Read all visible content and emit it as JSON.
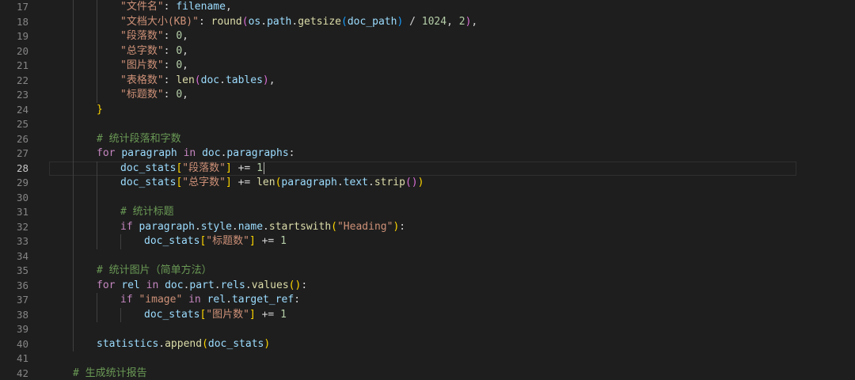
{
  "editor": {
    "current_line": 28,
    "lines": [
      {
        "no": "17",
        "tokens": [
          {
            "t": "\"文件名\"",
            "c": "str"
          },
          {
            "t": ": ",
            "c": "punc"
          },
          {
            "t": "filename",
            "c": "var"
          },
          {
            "t": ",",
            "c": "punc"
          }
        ]
      },
      {
        "no": "18",
        "tokens": [
          {
            "t": "\"文档大小(KB)\"",
            "c": "str"
          },
          {
            "t": ": ",
            "c": "punc"
          },
          {
            "t": "round",
            "c": "fn"
          },
          {
            "t": "(",
            "c": "br2"
          },
          {
            "t": "os",
            "c": "var"
          },
          {
            "t": ".",
            "c": "punc"
          },
          {
            "t": "path",
            "c": "var"
          },
          {
            "t": ".",
            "c": "punc"
          },
          {
            "t": "getsize",
            "c": "fn"
          },
          {
            "t": "(",
            "c": "br3"
          },
          {
            "t": "doc_path",
            "c": "var"
          },
          {
            "t": ")",
            "c": "br3"
          },
          {
            "t": " / ",
            "c": "punc"
          },
          {
            "t": "1024",
            "c": "num"
          },
          {
            "t": ", ",
            "c": "punc"
          },
          {
            "t": "2",
            "c": "num"
          },
          {
            "t": ")",
            "c": "br2"
          },
          {
            "t": ",",
            "c": "punc"
          }
        ]
      },
      {
        "no": "19",
        "tokens": [
          {
            "t": "\"段落数\"",
            "c": "str"
          },
          {
            "t": ": ",
            "c": "punc"
          },
          {
            "t": "0",
            "c": "num"
          },
          {
            "t": ",",
            "c": "punc"
          }
        ]
      },
      {
        "no": "20",
        "tokens": [
          {
            "t": "\"总字数\"",
            "c": "str"
          },
          {
            "t": ": ",
            "c": "punc"
          },
          {
            "t": "0",
            "c": "num"
          },
          {
            "t": ",",
            "c": "punc"
          }
        ]
      },
      {
        "no": "21",
        "tokens": [
          {
            "t": "\"图片数\"",
            "c": "str"
          },
          {
            "t": ": ",
            "c": "punc"
          },
          {
            "t": "0",
            "c": "num"
          },
          {
            "t": ",",
            "c": "punc"
          }
        ]
      },
      {
        "no": "22",
        "tokens": [
          {
            "t": "\"表格数\"",
            "c": "str"
          },
          {
            "t": ": ",
            "c": "punc"
          },
          {
            "t": "len",
            "c": "fn"
          },
          {
            "t": "(",
            "c": "br2"
          },
          {
            "t": "doc",
            "c": "var"
          },
          {
            "t": ".",
            "c": "punc"
          },
          {
            "t": "tables",
            "c": "var"
          },
          {
            "t": ")",
            "c": "br2"
          },
          {
            "t": ",",
            "c": "punc"
          }
        ]
      },
      {
        "no": "23",
        "tokens": [
          {
            "t": "\"标题数\"",
            "c": "str"
          },
          {
            "t": ": ",
            "c": "punc"
          },
          {
            "t": "0",
            "c": "num"
          },
          {
            "t": ",",
            "c": "punc"
          }
        ]
      },
      {
        "no": "24",
        "tokens": [
          {
            "t": "}",
            "c": "br1"
          }
        ]
      },
      {
        "no": "25",
        "tokens": []
      },
      {
        "no": "26",
        "tokens": [
          {
            "t": "# 统计段落和字数",
            "c": "cm"
          }
        ]
      },
      {
        "no": "27",
        "tokens": [
          {
            "t": "for",
            "c": "kw"
          },
          {
            "t": " ",
            "c": "punc"
          },
          {
            "t": "paragraph",
            "c": "var"
          },
          {
            "t": " ",
            "c": "punc"
          },
          {
            "t": "in",
            "c": "kw"
          },
          {
            "t": " ",
            "c": "punc"
          },
          {
            "t": "doc",
            "c": "var"
          },
          {
            "t": ".",
            "c": "punc"
          },
          {
            "t": "paragraphs",
            "c": "var"
          },
          {
            "t": ":",
            "c": "punc"
          }
        ]
      },
      {
        "no": "28",
        "tokens": [
          {
            "t": "doc_stats",
            "c": "var"
          },
          {
            "t": "[",
            "c": "br1"
          },
          {
            "t": "\"段落数\"",
            "c": "str"
          },
          {
            "t": "]",
            "c": "br1"
          },
          {
            "t": " += ",
            "c": "punc"
          },
          {
            "t": "1",
            "c": "num"
          }
        ]
      },
      {
        "no": "29",
        "tokens": [
          {
            "t": "doc_stats",
            "c": "var"
          },
          {
            "t": "[",
            "c": "br1"
          },
          {
            "t": "\"总字数\"",
            "c": "str"
          },
          {
            "t": "]",
            "c": "br1"
          },
          {
            "t": " += ",
            "c": "punc"
          },
          {
            "t": "len",
            "c": "fn"
          },
          {
            "t": "(",
            "c": "br1"
          },
          {
            "t": "paragraph",
            "c": "var"
          },
          {
            "t": ".",
            "c": "punc"
          },
          {
            "t": "text",
            "c": "var"
          },
          {
            "t": ".",
            "c": "punc"
          },
          {
            "t": "strip",
            "c": "fn"
          },
          {
            "t": "(",
            "c": "br2"
          },
          {
            "t": ")",
            "c": "br2"
          },
          {
            "t": ")",
            "c": "br1"
          }
        ]
      },
      {
        "no": "30",
        "tokens": []
      },
      {
        "no": "31",
        "tokens": [
          {
            "t": "# 统计标题",
            "c": "cm"
          }
        ]
      },
      {
        "no": "32",
        "tokens": [
          {
            "t": "if",
            "c": "kw"
          },
          {
            "t": " ",
            "c": "punc"
          },
          {
            "t": "paragraph",
            "c": "var"
          },
          {
            "t": ".",
            "c": "punc"
          },
          {
            "t": "style",
            "c": "var"
          },
          {
            "t": ".",
            "c": "punc"
          },
          {
            "t": "name",
            "c": "var"
          },
          {
            "t": ".",
            "c": "punc"
          },
          {
            "t": "startswith",
            "c": "fn"
          },
          {
            "t": "(",
            "c": "br1"
          },
          {
            "t": "\"Heading\"",
            "c": "str"
          },
          {
            "t": ")",
            "c": "br1"
          },
          {
            "t": ":",
            "c": "punc"
          }
        ]
      },
      {
        "no": "33",
        "tokens": [
          {
            "t": "doc_stats",
            "c": "var"
          },
          {
            "t": "[",
            "c": "br1"
          },
          {
            "t": "\"标题数\"",
            "c": "str"
          },
          {
            "t": "]",
            "c": "br1"
          },
          {
            "t": " += ",
            "c": "punc"
          },
          {
            "t": "1",
            "c": "num"
          }
        ]
      },
      {
        "no": "34",
        "tokens": []
      },
      {
        "no": "35",
        "tokens": [
          {
            "t": "# 统计图片（简单方法）",
            "c": "cm"
          }
        ]
      },
      {
        "no": "36",
        "tokens": [
          {
            "t": "for",
            "c": "kw"
          },
          {
            "t": " ",
            "c": "punc"
          },
          {
            "t": "rel",
            "c": "var"
          },
          {
            "t": " ",
            "c": "punc"
          },
          {
            "t": "in",
            "c": "kw"
          },
          {
            "t": " ",
            "c": "punc"
          },
          {
            "t": "doc",
            "c": "var"
          },
          {
            "t": ".",
            "c": "punc"
          },
          {
            "t": "part",
            "c": "var"
          },
          {
            "t": ".",
            "c": "punc"
          },
          {
            "t": "rels",
            "c": "var"
          },
          {
            "t": ".",
            "c": "punc"
          },
          {
            "t": "values",
            "c": "fn"
          },
          {
            "t": "(",
            "c": "br1"
          },
          {
            "t": ")",
            "c": "br1"
          },
          {
            "t": ":",
            "c": "punc"
          }
        ]
      },
      {
        "no": "37",
        "tokens": [
          {
            "t": "if",
            "c": "kw"
          },
          {
            "t": " ",
            "c": "punc"
          },
          {
            "t": "\"image\"",
            "c": "str"
          },
          {
            "t": " ",
            "c": "punc"
          },
          {
            "t": "in",
            "c": "kw"
          },
          {
            "t": " ",
            "c": "punc"
          },
          {
            "t": "rel",
            "c": "var"
          },
          {
            "t": ".",
            "c": "punc"
          },
          {
            "t": "target_ref",
            "c": "var"
          },
          {
            "t": ":",
            "c": "punc"
          }
        ]
      },
      {
        "no": "38",
        "tokens": [
          {
            "t": "doc_stats",
            "c": "var"
          },
          {
            "t": "[",
            "c": "br1"
          },
          {
            "t": "\"图片数\"",
            "c": "str"
          },
          {
            "t": "]",
            "c": "br1"
          },
          {
            "t": " += ",
            "c": "punc"
          },
          {
            "t": "1",
            "c": "num"
          }
        ]
      },
      {
        "no": "39",
        "tokens": []
      },
      {
        "no": "40",
        "tokens": [
          {
            "t": "statistics",
            "c": "var"
          },
          {
            "t": ".",
            "c": "punc"
          },
          {
            "t": "append",
            "c": "fn"
          },
          {
            "t": "(",
            "c": "br1"
          },
          {
            "t": "doc_stats",
            "c": "var"
          },
          {
            "t": ")",
            "c": "br1"
          }
        ]
      },
      {
        "no": "41",
        "tokens": []
      },
      {
        "no": "42",
        "tokens": [
          {
            "t": "# 生成统计报告",
            "c": "cm"
          }
        ]
      }
    ]
  }
}
